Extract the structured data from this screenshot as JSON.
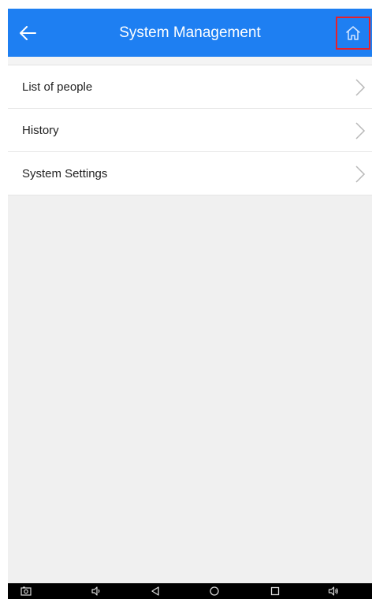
{
  "header": {
    "title": "System Management",
    "back_icon": "arrow-left-icon",
    "home_icon": "home-icon",
    "color": "#1e7ff2",
    "highlight_color": "#e8202a"
  },
  "menu": {
    "items": [
      {
        "label": "List of people"
      },
      {
        "label": "History"
      },
      {
        "label": "System Settings"
      }
    ]
  },
  "navbar": {
    "icons": [
      "screenshot-icon",
      "volume-down-icon",
      "back-triangle-icon",
      "home-circle-icon",
      "recent-apps-icon",
      "volume-up-icon"
    ]
  }
}
